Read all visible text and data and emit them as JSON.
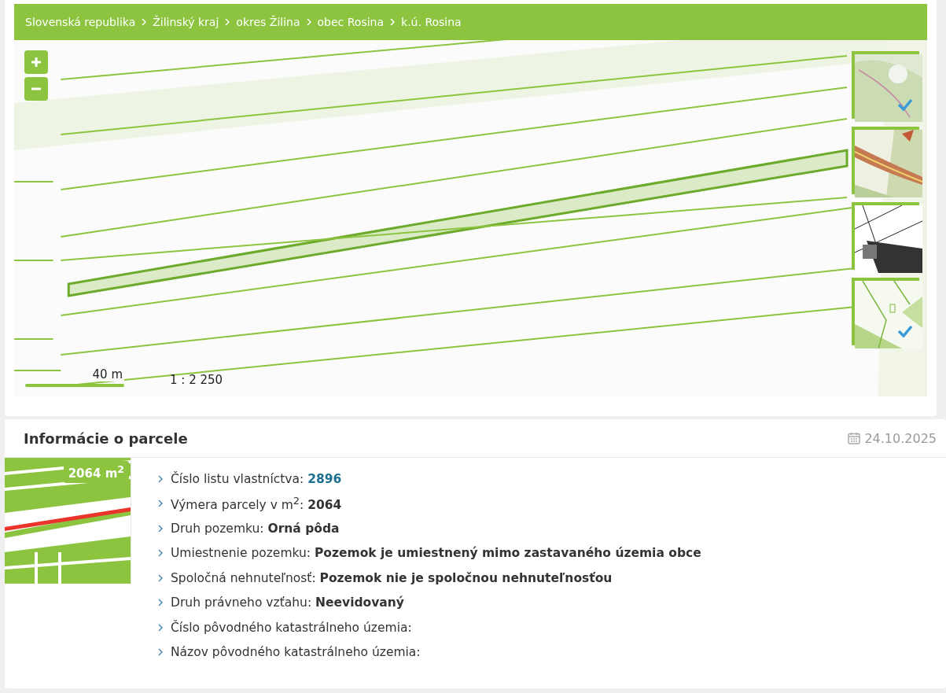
{
  "breadcrumb": [
    "Slovenská republika",
    "Žilinský kraj",
    "okres Žilina",
    "obec Rosina",
    "k.ú. Rosina"
  ],
  "map": {
    "kind": "picture",
    "scale": {
      "label": "40 m",
      "ratio": "1 : 2 250"
    },
    "layers": [
      {
        "kind": "picture",
        "checked": true
      },
      {
        "kind": "picture",
        "checked": false
      },
      {
        "kind": "picture",
        "checked": false
      },
      {
        "kind": "picture",
        "checked": true
      }
    ]
  },
  "parcel_info": {
    "title": "Informácie o parcele",
    "date": "24.10.2025",
    "area_badge": "2064 m$^{2}$",
    "items": [
      {
        "kind": "link",
        "label": "Číslo listu vlastníctva:",
        "link": "2896"
      },
      {
        "kind": "text",
        "text": "Výmera parcely v m$^{2}$: **2064**"
      },
      {
        "kind": "text",
        "text": "Druh pozemku: **Orná pôda**"
      },
      {
        "kind": "text",
        "text": "Umiestnenie pozemku: **Pozemok je umiestnený mimo zastavaného územia obce**"
      },
      {
        "kind": "text",
        "text": "Spoločná nehnuteľnosť: **Pozemok nie je spoločnou nehnuteľnosťou**"
      },
      {
        "kind": "text",
        "text": "Druh právneho vzťahu: **Neevidovaný**"
      },
      {
        "kind": "text",
        "text": "Číslo pôvodného katastrálneho územia:"
      },
      {
        "kind": "text",
        "text": "Názov pôvodného katastrálneho územia:"
      }
    ]
  }
}
